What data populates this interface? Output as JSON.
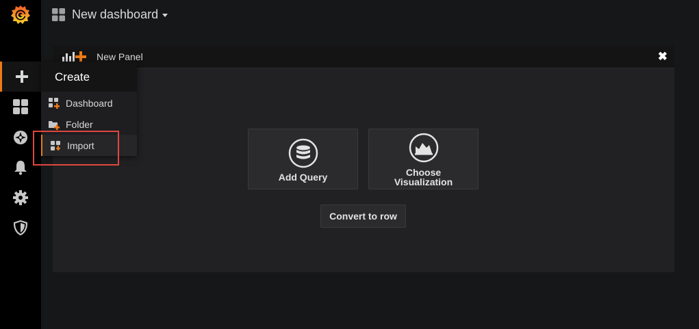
{
  "topbar": {
    "dashboard_title": "New dashboard"
  },
  "panel": {
    "title": "New Panel",
    "close_glyph": "✖",
    "actions": [
      {
        "label": "Add Query",
        "icon": "database-icon"
      },
      {
        "label_line1": "Choose",
        "label_line2": "Visualization",
        "icon": "area-chart-icon"
      }
    ],
    "convert_label": "Convert to row"
  },
  "sidemenu": {
    "items": [
      "grafana-logo",
      "plus-icon",
      "dashboards-icon",
      "explore-compass-icon",
      "alerting-bell-icon",
      "configuration-gear-icon",
      "server-admin-shield-icon"
    ]
  },
  "create_menu": {
    "header": "Create",
    "items": [
      {
        "label": "Dashboard",
        "icon": "dashboard-add-icon"
      },
      {
        "label": "Folder",
        "icon": "folder-add-icon"
      },
      {
        "label": "Import",
        "icon": "import-icon"
      }
    ]
  },
  "colors": {
    "accent": "#eb7b18",
    "highlight_box": "#e0473f",
    "background": "#161719",
    "panel": "#212124"
  }
}
